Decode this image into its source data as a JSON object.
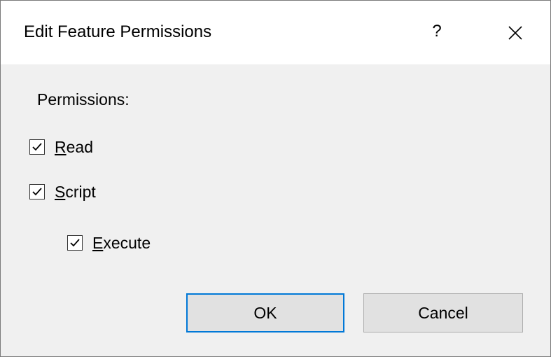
{
  "dialog": {
    "title": "Edit Feature Permissions",
    "help_label": "?",
    "close_icon": "close-icon"
  },
  "permissions": {
    "label": "Permissions:",
    "items": [
      {
        "label_first": "R",
        "label_rest": "ead",
        "checked": true
      },
      {
        "label_first": "S",
        "label_rest": "cript",
        "checked": true
      },
      {
        "label_first": "E",
        "label_rest": "xecute",
        "checked": true
      }
    ]
  },
  "buttons": {
    "ok": "OK",
    "cancel": "Cancel"
  },
  "colors": {
    "accent": "#0078d7",
    "title_bg": "#ffffff",
    "body_bg": "#f0f0f0",
    "button_bg": "#e1e1e1"
  }
}
